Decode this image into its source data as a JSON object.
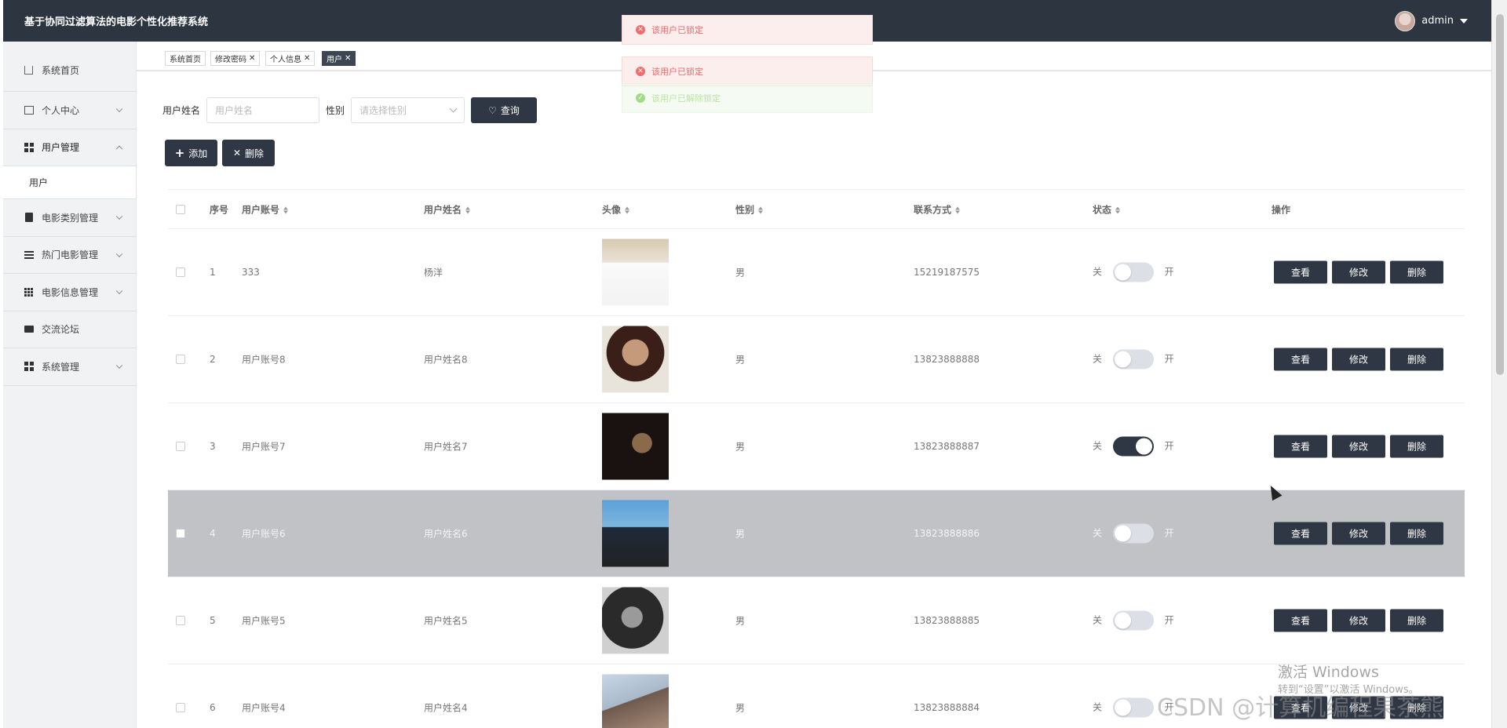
{
  "header": {
    "title": "基于协同过滤算法的电影个性化推荐系统",
    "user": "admin"
  },
  "sidebar": {
    "items": [
      {
        "label": "系统首页",
        "icon": "home-icon"
      },
      {
        "label": "个人中心",
        "icon": "id-card-icon"
      },
      {
        "label": "用户管理",
        "icon": "grid-icon"
      },
      {
        "label": "电影类别管理",
        "icon": "clipboard-icon"
      },
      {
        "label": "热门电影管理",
        "icon": "sliders-icon"
      },
      {
        "label": "电影信息管理",
        "icon": "grid-icon"
      },
      {
        "label": "交流论坛",
        "icon": "camera-icon"
      },
      {
        "label": "系统管理",
        "icon": "grid-icon"
      }
    ],
    "sub": {
      "label": "用户"
    }
  },
  "tabs": [
    {
      "label": "系统首页"
    },
    {
      "label": "修改密码"
    },
    {
      "label": "个人信息"
    },
    {
      "label": "用户"
    }
  ],
  "search": {
    "name_label": "用户姓名",
    "name_placeholder": "用户姓名",
    "gender_label": "性别",
    "gender_placeholder": "请选择性别",
    "query_button": "查询"
  },
  "actions": {
    "add": "添加",
    "delete": "删除"
  },
  "table": {
    "headers": {
      "index": "序号",
      "account": "用户账号",
      "name": "用户姓名",
      "avatar": "头像",
      "gender": "性别",
      "contact": "联系方式",
      "status": "状态",
      "ops": "操作"
    },
    "switch_off": "关",
    "switch_on": "开",
    "op_view": "查看",
    "op_edit": "修改",
    "op_delete": "删除",
    "rows": [
      {
        "index": "1",
        "account": "333",
        "name": "杨洋",
        "gender": "男",
        "contact": "15219187575",
        "status_on": false
      },
      {
        "index": "2",
        "account": "用户账号8",
        "name": "用户姓名8",
        "gender": "男",
        "contact": "13823888888",
        "status_on": false
      },
      {
        "index": "3",
        "account": "用户账号7",
        "name": "用户姓名7",
        "gender": "男",
        "contact": "13823888887",
        "status_on": true
      },
      {
        "index": "4",
        "account": "用户账号6",
        "name": "用户姓名6",
        "gender": "男",
        "contact": "13823888886",
        "status_on": false
      },
      {
        "index": "5",
        "account": "用户账号5",
        "name": "用户姓名5",
        "gender": "男",
        "contact": "13823888885",
        "status_on": false
      },
      {
        "index": "6",
        "account": "用户账号4",
        "name": "用户姓名4",
        "gender": "男",
        "contact": "13823888884",
        "status_on": false
      }
    ]
  },
  "notifications": [
    {
      "text": "该用户已锁定",
      "type": "error"
    },
    {
      "text": "该用户已锁定",
      "type": "error"
    },
    {
      "text": "该用户已解除锁定",
      "type": "success"
    }
  ],
  "watermark": {
    "line1": "激活 Windows",
    "line2": "转到“设置”以激活 Windows。",
    "csdn": "CSDN @计算机编程果茶熊"
  }
}
